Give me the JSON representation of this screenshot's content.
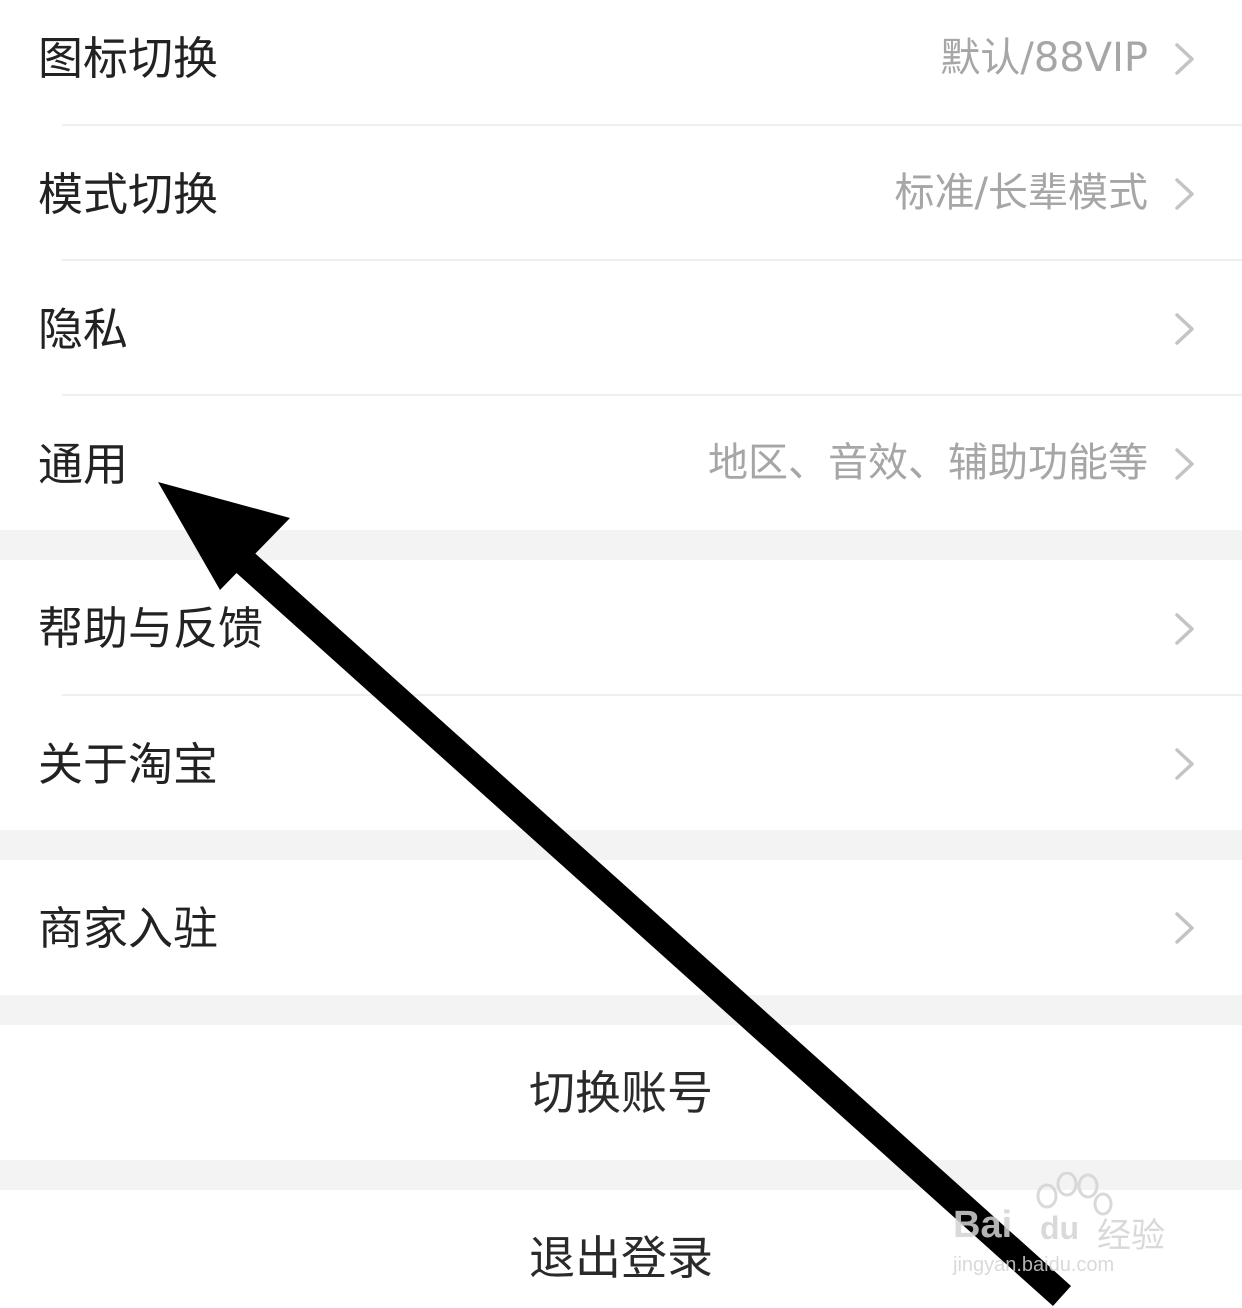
{
  "settings": {
    "rows": [
      {
        "label": "图标切换",
        "value": "默认/88VIP"
      },
      {
        "label": "模式切换",
        "value": "标准/长辈模式"
      },
      {
        "label": "隐私",
        "value": ""
      },
      {
        "label": "通用",
        "value": "地区、音效、辅助功能等"
      },
      {
        "label": "帮助与反馈",
        "value": ""
      },
      {
        "label": "关于淘宝",
        "value": ""
      },
      {
        "label": "商家入驻",
        "value": ""
      }
    ],
    "switch_account": "切换账号",
    "logout": "退出登录"
  },
  "icons": {
    "chevron": "chevron-right-icon",
    "annotation": "arrow-annotation-icon"
  },
  "watermark": {
    "brand": "Bai",
    "brand2": "du",
    "product": "经验",
    "url": "jingyan.baidu.com"
  },
  "colors": {
    "label": "#222222",
    "value": "#a6a6a6",
    "chevron": "#c4c4c4",
    "section_gap": "#f3f3f3",
    "arrow": "#000000"
  }
}
